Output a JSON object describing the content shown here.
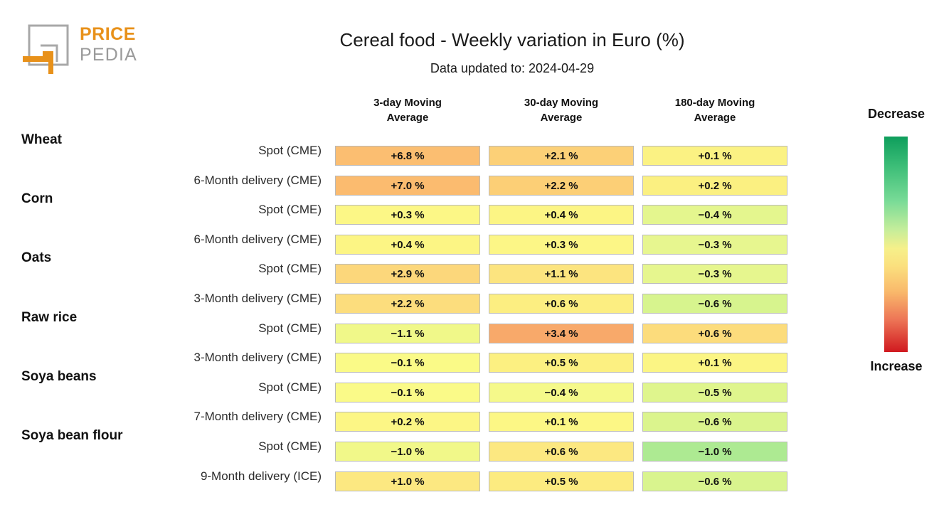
{
  "logo": {
    "brand_primary": "PRICE",
    "brand_secondary": "PEDIA",
    "color_orange": "#E8911A",
    "color_gray": "#9a9a9a"
  },
  "header": {
    "title": "Cereal food - Weekly variation in Euro (%)",
    "subtitle": "Data updated to: 2024-04-29"
  },
  "legend": {
    "top_label": "Decrease",
    "bottom_label": "Increase",
    "top_color": "#0E9E5C",
    "mid_color": "#F6F08A",
    "bottom_color": "#D0191F"
  },
  "chart_data": {
    "type": "heatmap",
    "title": "Cereal food - Weekly variation in Euro (%)",
    "subtitle": "Data updated to: 2024-04-29",
    "xlabel": "",
    "ylabel": "",
    "grid": false,
    "legend_position": "right",
    "columns": [
      "3-day Moving Average",
      "30-day Moving Average",
      "180-day Moving Average"
    ],
    "column_lines": [
      [
        "3-day Moving",
        "Average"
      ],
      [
        "30-day Moving",
        "Average"
      ],
      [
        "180-day Moving",
        "Average"
      ]
    ],
    "rows": [
      {
        "group": "Wheat",
        "contract": "Spot (CME)",
        "values": [
          6.8,
          2.1,
          0.1
        ],
        "labels": [
          "+6.8 %",
          "+2.1 %",
          "+0.1 %"
        ],
        "colors": [
          "#FBBE71",
          "#FCD077",
          "#FBF283"
        ]
      },
      {
        "group": "",
        "contract": "6-Month delivery (CME)",
        "values": [
          7.0,
          2.2,
          0.2
        ],
        "labels": [
          "+7.0 %",
          "+2.2 %",
          "+0.2 %"
        ],
        "colors": [
          "#FBBB6F",
          "#FCCF76",
          "#FBF081"
        ]
      },
      {
        "group": "Corn",
        "contract": "Spot (CME)",
        "values": [
          0.3,
          0.4,
          -0.4
        ],
        "labels": [
          "+0.3 %",
          "+0.4 %",
          "−0.4 %"
        ],
        "colors": [
          "#FCF786",
          "#FCF584",
          "#E4F68E"
        ]
      },
      {
        "group": "",
        "contract": "6-Month delivery (CME)",
        "values": [
          0.4,
          0.3,
          -0.3
        ],
        "labels": [
          "+0.4 %",
          "+0.3 %",
          "−0.3 %"
        ],
        "colors": [
          "#FCF584",
          "#FCF686",
          "#E7F68F"
        ]
      },
      {
        "group": "Oats",
        "contract": "Spot (CME)",
        "values": [
          2.9,
          1.1,
          -0.3
        ],
        "labels": [
          "+2.9 %",
          "+1.1 %",
          "−0.3 %"
        ],
        "colors": [
          "#FCD77B",
          "#FCE47F",
          "#E6F68E"
        ]
      },
      {
        "group": "",
        "contract": "3-Month delivery (CME)",
        "values": [
          2.2,
          0.6,
          -0.6
        ],
        "labels": [
          "+2.2 %",
          "+0.6 %",
          "−0.6 %"
        ],
        "colors": [
          "#FCDD7D",
          "#FCEE81",
          "#D7F48E"
        ]
      },
      {
        "group": "Raw rice",
        "contract": "Spot (CME)",
        "values": [
          -1.1,
          3.4,
          0.6
        ],
        "labels": [
          "−1.1 %",
          "+3.4 %",
          "+0.6 %"
        ],
        "colors": [
          "#F0F889",
          "#F8A96A",
          "#FCDC7C"
        ]
      },
      {
        "group": "",
        "contract": "3-Month delivery (CME)",
        "values": [
          -0.1,
          0.5,
          0.1
        ],
        "labels": [
          "−0.1 %",
          "+0.5 %",
          "+0.1 %"
        ],
        "colors": [
          "#FAFA87",
          "#FCF081",
          "#FBF584"
        ]
      },
      {
        "group": "Soya beans",
        "contract": "Spot (CME)",
        "values": [
          -0.1,
          -0.4,
          -0.5
        ],
        "labels": [
          "−0.1 %",
          "−0.4 %",
          "−0.5 %"
        ],
        "colors": [
          "#FAFA88",
          "#F5F98A",
          "#DFF58D"
        ]
      },
      {
        "group": "",
        "contract": "7-Month delivery (CME)",
        "values": [
          0.2,
          0.1,
          -0.6
        ],
        "labels": [
          "+0.2 %",
          "+0.1 %",
          "−0.6 %"
        ],
        "colors": [
          "#FCF685",
          "#FCF785",
          "#DBF48D"
        ]
      },
      {
        "group": "Soya bean flour",
        "contract": "Spot (CME)",
        "values": [
          -1.0,
          0.6,
          -1.0
        ],
        "labels": [
          "−1.0 %",
          "+0.6 %",
          "−1.0 %"
        ],
        "colors": [
          "#F1F889",
          "#FCE881",
          "#ADEA92"
        ]
      },
      {
        "group": "",
        "contract": "9-Month delivery (ICE)",
        "values": [
          1.0,
          0.5,
          -0.6
        ],
        "labels": [
          "+1.0 %",
          "+0.5 %",
          "−0.6 %"
        ],
        "colors": [
          "#FCE881",
          "#FCEB80",
          "#D9F48E"
        ]
      }
    ]
  }
}
